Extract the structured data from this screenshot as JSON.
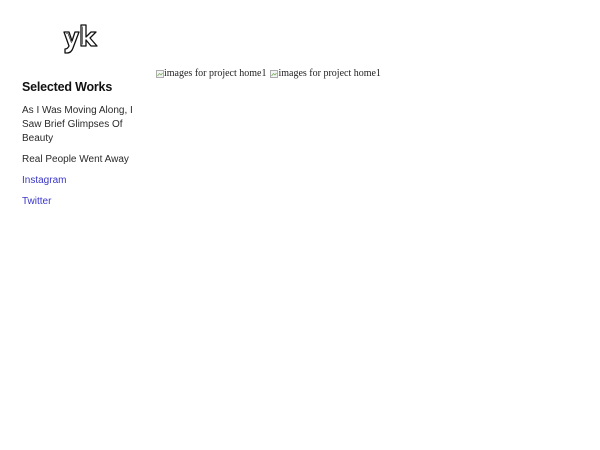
{
  "logo": {
    "text": "yk"
  },
  "sidebar": {
    "section_title": "Selected Works",
    "projects": [
      {
        "label": "As I Was Moving Along, I Saw Brief Glimpses Of Beauty"
      },
      {
        "label": "Real People Went Away"
      }
    ],
    "social": [
      {
        "label": "Instagram"
      },
      {
        "label": "Twitter"
      }
    ]
  },
  "gallery": {
    "images": [
      {
        "alt": "images for project home1"
      },
      {
        "alt": "images for project home1"
      }
    ]
  },
  "colors": {
    "social_link": "#3a36c8",
    "text": "#222222",
    "background": "#ffffff"
  }
}
